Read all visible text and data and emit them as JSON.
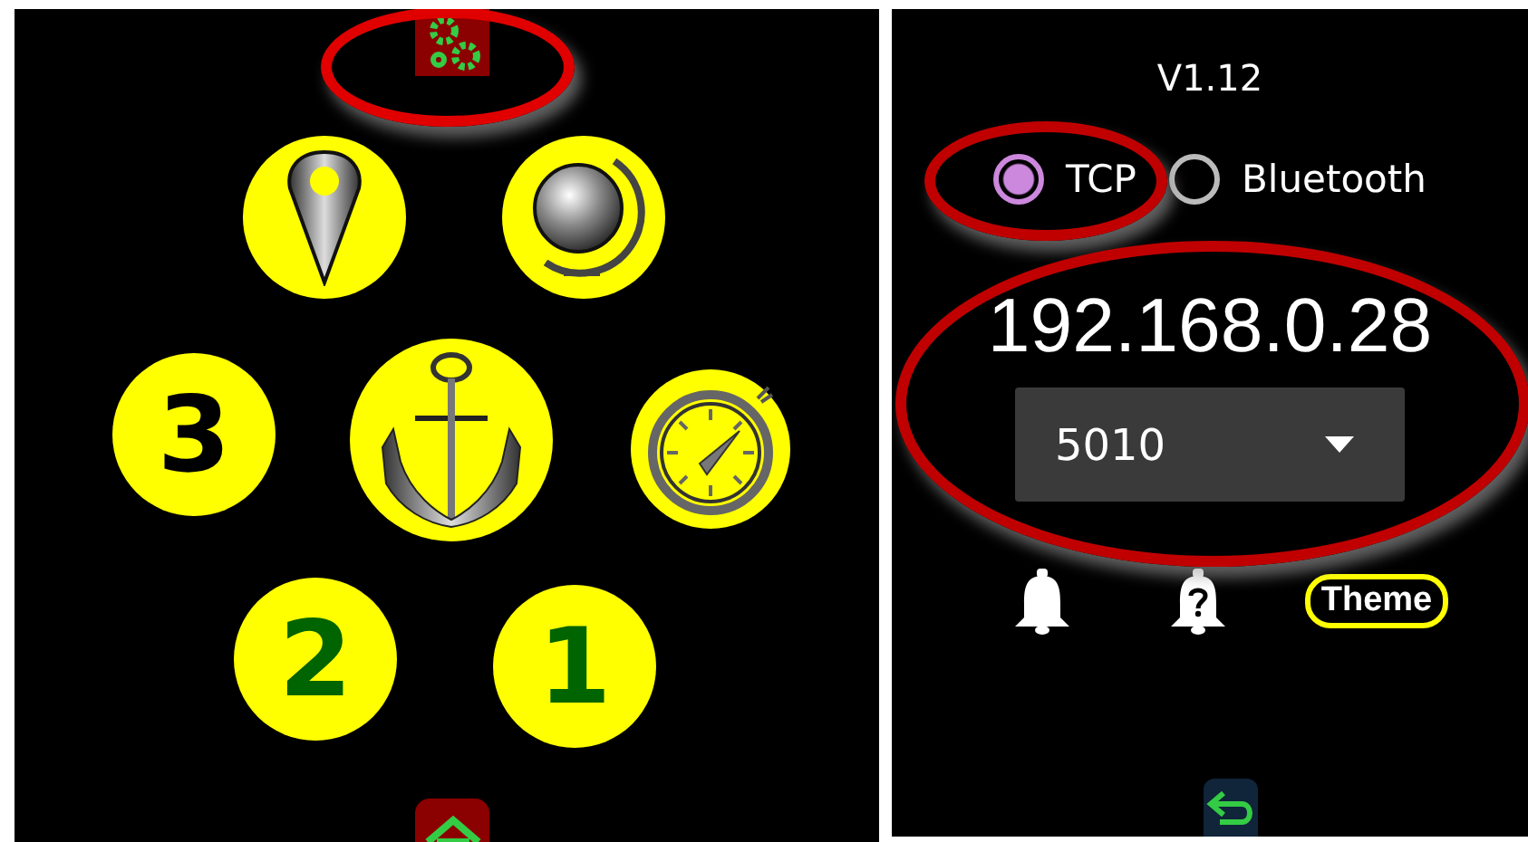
{
  "menu_panel": {
    "settings_tab": {
      "highlighted": true
    },
    "buttons": [
      {
        "kind": "pin"
      },
      {
        "kind": "globe"
      },
      {
        "kind": "number",
        "label": "3",
        "color": "#000000"
      },
      {
        "kind": "anchor"
      },
      {
        "kind": "stopwatch"
      },
      {
        "kind": "number",
        "label": "2",
        "color": "#006400"
      },
      {
        "kind": "number",
        "label": "1",
        "color": "#006400"
      }
    ],
    "home_tab": {
      "kind": "home"
    }
  },
  "settings_panel": {
    "version": "V1.12",
    "connection_types": [
      {
        "label": "TCP",
        "selected": true,
        "highlighted": true
      },
      {
        "label": "Bluetooth",
        "selected": false,
        "highlighted": false
      }
    ],
    "connection": {
      "highlighted": true,
      "address": "192.168.0.28",
      "port": "5010"
    },
    "actions": [
      {
        "kind": "bell"
      },
      {
        "kind": "bell-question"
      },
      {
        "kind": "text",
        "label": "Theme"
      }
    ]
  }
}
